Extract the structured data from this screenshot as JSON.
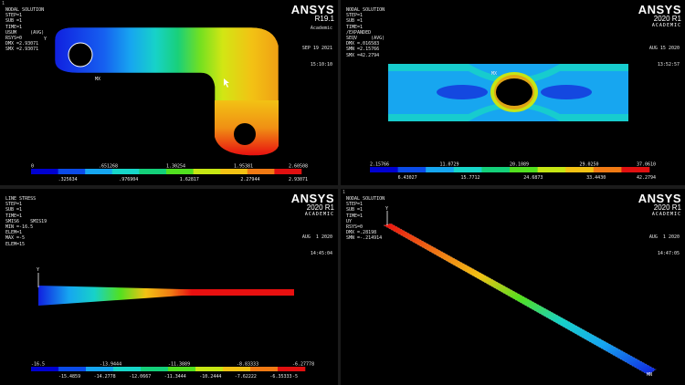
{
  "panels": [
    {
      "name": "panel-1",
      "header": [
        "NODAL SOLUTION",
        "STEP=1",
        "SUB =1",
        "TIME=1",
        "USUM     (AVG)",
        "RSYS=0",
        "DMX =2.93071",
        "SMX =2.93071"
      ],
      "brand": {
        "name": "ANSYS",
        "version": "R19.1",
        "edition": "Academic"
      },
      "stamp": [
        "SEP 19 2021",
        "15:10:10"
      ],
      "legend_colors": [
        "#0000d0",
        "#0b4be8",
        "#16a6f0",
        "#17d6c9",
        "#14d07a",
        "#52e020",
        "#c6e614",
        "#f2c214",
        "#f07a14",
        "#e01010"
      ],
      "legend_top": [
        "0",
        ".651268",
        "1.30254",
        "1.95381",
        "2.60508"
      ],
      "legend_bottom": [
        ".325634",
        ".976904",
        "1.62817",
        "2.27944",
        "2.93071"
      ]
    },
    {
      "name": "panel-2",
      "header": [
        "1",
        "NODAL SOLUTION",
        "STEP=1",
        "SUB =1",
        "TIME=1",
        "/EXPANDED",
        "SEQV     (AVG)",
        "DMX =.016583",
        "SMN =2.15766",
        "SMX =42.2794"
      ],
      "brand": {
        "name": "ANSYS",
        "version": "2020 R1",
        "edition": "ACADEMIC"
      },
      "stamp": [
        "AUG 15 2020",
        "13:52:57"
      ],
      "legend_colors": [
        "#0000d0",
        "#0b4be8",
        "#16a6f0",
        "#17d6c9",
        "#14d07a",
        "#52e020",
        "#c6e614",
        "#f2c214",
        "#f07a14",
        "#e01010"
      ],
      "legend_top": [
        "2.15766",
        "11.0729",
        "20.1089",
        "29.0250",
        "37.0610"
      ],
      "legend_bottom": [
        "6.43027",
        "15.7712",
        "24.6873",
        "33.4430",
        "42.2794"
      ]
    },
    {
      "name": "panel-3",
      "header": [
        "LINE STRESS",
        "STEP=1",
        "SUB =1",
        "TIME=1",
        "SMIS6    SMIS19",
        "MIN =-16.5",
        "ELEM=1",
        "MAX =-5",
        "ELEM=15"
      ],
      "brand": {
        "name": "ANSYS",
        "version": "2020 R1",
        "edition": "ACADEMIC"
      },
      "stamp": [
        "AUG  1 2020",
        "14:45:04"
      ],
      "legend_colors": [
        "#0000d0",
        "#0b4be8",
        "#16a6f0",
        "#17d6c9",
        "#14d07a",
        "#52e020",
        "#c6e614",
        "#f2c214",
        "#f07a14",
        "#e01010"
      ],
      "legend_top": [
        "-16.5",
        "-13.9444",
        "-11.3889",
        "-8.83333",
        "-6.27778"
      ],
      "legend_bottom": [
        "-15.4859",
        "-14.2778",
        "-12.0667",
        "-11.3444",
        "-10.2444",
        "-7.62222",
        "-6.35333",
        "-5"
      ]
    },
    {
      "name": "panel-4",
      "header": [
        "1",
        "NODAL SOLUTION",
        "STEP=1",
        "SUB =1",
        "TIME=1",
        "UY",
        "RSYS=0",
        "DMX =.28198",
        "SMN =-.214914"
      ],
      "brand": {
        "name": "ANSYS",
        "version": "2020 R1",
        "edition": "ACADEMIC"
      },
      "stamp": [
        "AUG  1 2020",
        "14:47:05"
      ]
    }
  ]
}
